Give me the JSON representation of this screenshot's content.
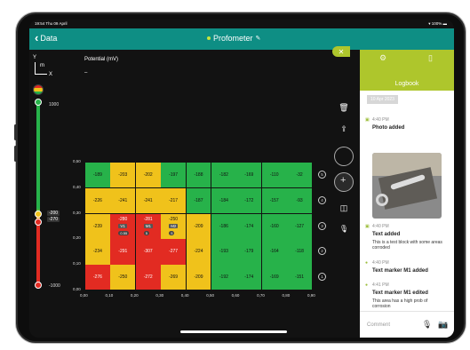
{
  "status": {
    "time": "19:54 Thu 09 April",
    "battery": "100%"
  },
  "header": {
    "back_label": "Data",
    "title": "Profometer"
  },
  "axes": {
    "y": "Y",
    "m": "m",
    "x": "X"
  },
  "scale": {
    "top_label": "1000",
    "bottom_label": "-1000",
    "marker1": "-200",
    "marker2": "-270",
    "colors": {
      "green": "#27b24a",
      "yellow": "#f0c21b",
      "red": "#e22b22"
    }
  },
  "chart": {
    "title": "Potential (mV)",
    "dash": "–"
  },
  "chart_data": {
    "type": "heatmap",
    "title": "Potential (mV)",
    "x_ticks": [
      "0,00",
      "0,10",
      "0,20",
      "0,30",
      "0,40",
      "0,50",
      "0,60",
      "0,70",
      "0,80",
      "0,90"
    ],
    "y_ticks": [
      "0,00",
      "0,10",
      "0,20",
      "0,30",
      "0,40",
      "0,50"
    ],
    "row_labels": [
      "5",
      "4",
      "3",
      "2",
      "1"
    ],
    "rows": [
      [
        -189,
        -203,
        -202,
        -197,
        -188,
        -182,
        -169,
        -110,
        -32
      ],
      [
        -226,
        -241,
        -241,
        -217,
        -187,
        -184,
        -172,
        -157,
        -93
      ],
      [
        -239,
        -280,
        -281,
        -250,
        -209,
        -186,
        -174,
        -160,
        -127
      ],
      [
        -234,
        -291,
        -307,
        -277,
        -224,
        -193,
        -179,
        -164,
        -118
      ],
      [
        -276,
        -250,
        -272,
        -269,
        -209,
        -192,
        -174,
        -169,
        -151
      ]
    ],
    "colors": [
      [
        "green",
        "yellow",
        "yellow",
        "green",
        "green",
        "green",
        "green",
        "green",
        "green"
      ],
      [
        "yellow",
        "yellow",
        "yellow",
        "yellow",
        "green",
        "green",
        "green",
        "green",
        "green"
      ],
      [
        "yellow",
        "red",
        "red",
        "yellow",
        "yellow",
        "green",
        "green",
        "green",
        "green"
      ],
      [
        "yellow",
        "red",
        "red",
        "red",
        "yellow",
        "green",
        "green",
        "green",
        "green"
      ],
      [
        "red",
        "yellow",
        "red",
        "yellow",
        "yellow",
        "green",
        "green",
        "green",
        "green"
      ]
    ],
    "markers": [
      {
        "label": "V1",
        "row": 2,
        "col": 1
      },
      {
        "label": "M1",
        "row": 2,
        "col": 2
      },
      {
        "label": "M2",
        "row": 2,
        "col": 3
      }
    ],
    "marker_badges": [
      {
        "label": "0.55",
        "row": 2,
        "col": 1
      },
      {
        "label": "5",
        "row": 2,
        "col": 2
      },
      {
        "label": "5",
        "row": 2,
        "col": 3
      }
    ]
  },
  "logbook": {
    "title": "Logbook",
    "date": "10 Apr 2023",
    "entries": [
      {
        "time": "4:40 PM",
        "title": "Photo added",
        "body": ""
      },
      {
        "time": "4:40 PM",
        "title": "Text added",
        "body": "This is a test block with some areas corroded"
      },
      {
        "time": "4:40 PM",
        "title": "Text marker M1 added",
        "body": ""
      },
      {
        "time": "4:41 PM",
        "title": "Text marker M1 edited",
        "body": "This area has a high prob of corrosion"
      }
    ],
    "comment_placeholder": "Comment"
  }
}
